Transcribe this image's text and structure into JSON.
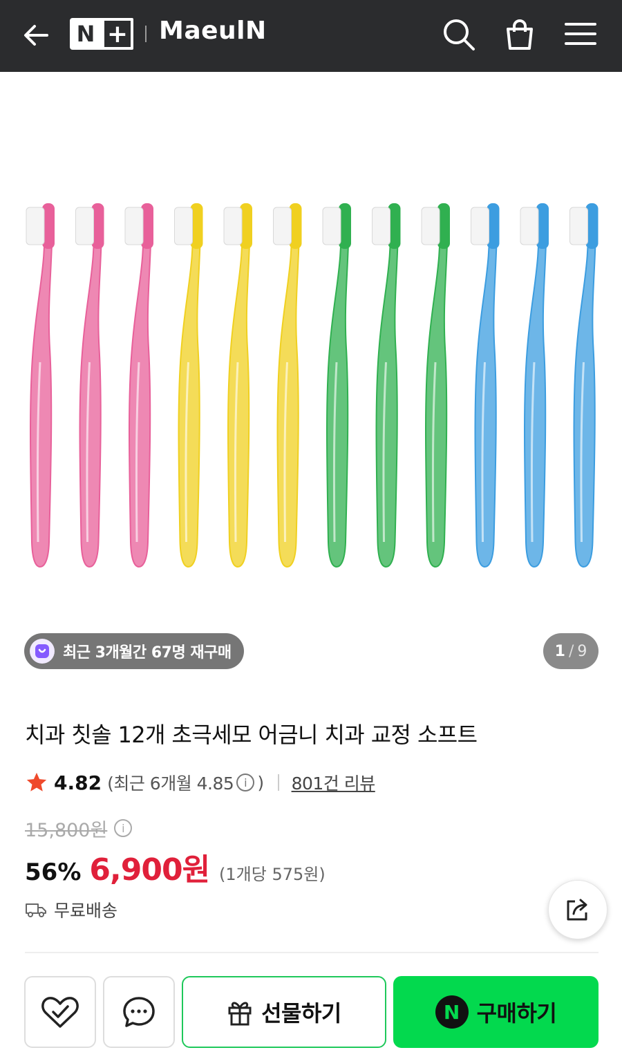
{
  "header": {
    "logo_n": "N",
    "logo_plus": "+",
    "brand": "MaeulN",
    "icons": [
      "back-arrow-icon",
      "search-icon",
      "shopping-bag-icon",
      "menu-icon"
    ]
  },
  "product_image": {
    "description_icon": "toothbrushes-image",
    "colors": [
      "#e8609a",
      "#f0d020",
      "#30b050",
      "#3c9de0"
    ],
    "repurchase_badge": "최근 3개월간 67명 재구매",
    "pager": {
      "current": "1",
      "separator": "/",
      "total": "9"
    }
  },
  "product": {
    "title": "치과 칫솔 12개 초극세모 어금니 치과 교정 소프트",
    "rating": "4.82",
    "recent_rating_open": "(최근 6개월 4.85",
    "recent_rating_close": ")",
    "info_glyph": "i",
    "reviews": "801건 리뷰",
    "original_price": "15,800원",
    "discount": "56%",
    "price": "6,900원",
    "unit_price": "(1개당 575원)",
    "shipping": "무료배송"
  },
  "bottom_bar": {
    "gift_label": "선물하기",
    "buy_label": "구매하기",
    "npay_glyph": "N"
  },
  "colors": {
    "header_bg": "#2b2c2e",
    "price_red": "#e0203a",
    "npay_green": "#03d94e",
    "star": "#ef4a2c"
  }
}
